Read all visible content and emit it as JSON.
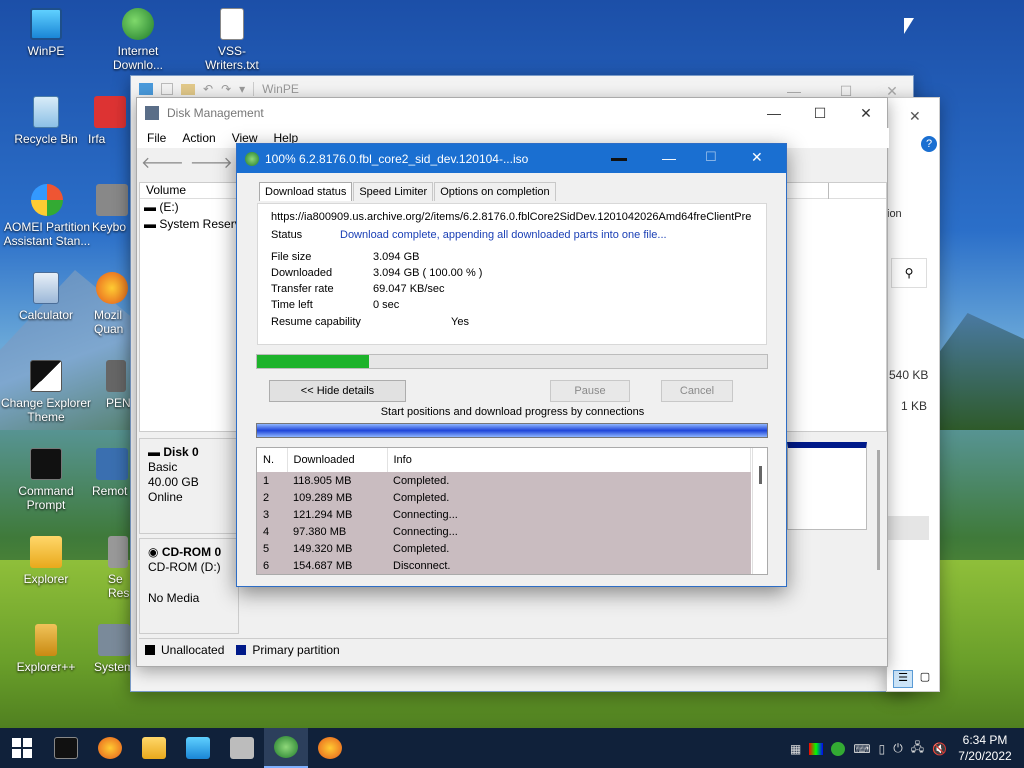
{
  "desktop": {
    "icons": [
      {
        "label": "WinPE",
        "icon": "monitor-icon"
      },
      {
        "label": "Internet Downlo...",
        "icon": "idm-globe-icon"
      },
      {
        "label": "VSS-Writers.txt",
        "icon": "text-file-icon"
      },
      {
        "label": "Recycle Bin",
        "icon": "recycle-bin-icon"
      },
      {
        "label": "Irfa",
        "icon": "app-icon"
      },
      {
        "label": "AOMEI Partition Assistant Stan...",
        "icon": "aomei-icon"
      },
      {
        "label": "Keybo",
        "icon": "app-icon"
      },
      {
        "label": "Calculator",
        "icon": "calculator-icon"
      },
      {
        "label": "Mozil Quan",
        "icon": "firefox-icon"
      },
      {
        "label": "Change Explorer Theme",
        "icon": "theme-icon"
      },
      {
        "label": "PEN",
        "icon": "app-icon"
      },
      {
        "label": "Command Prompt",
        "icon": "cmd-icon"
      },
      {
        "label": "Remot",
        "icon": "app-icon"
      },
      {
        "label": "Explorer",
        "icon": "folder-icon"
      },
      {
        "label": "Se Res",
        "icon": "app-icon"
      },
      {
        "label": "Explorer++",
        "icon": "explorer-plus-icon"
      },
      {
        "label": "System",
        "icon": "app-icon"
      }
    ]
  },
  "back_window": {
    "title": "WinPE"
  },
  "right_window": {
    "text_ion": "ion",
    "size1": "540 KB",
    "size2": "1 KB"
  },
  "disk_mgmt": {
    "title": "Disk Management",
    "menu": [
      "File",
      "Action",
      "View",
      "Help"
    ],
    "volume_header": "Volume",
    "volumes": [
      "(E:)",
      "System Reserve"
    ],
    "disk0": {
      "name": "Disk 0",
      "type": "Basic",
      "size": "40.00 GB",
      "status": "Online"
    },
    "cdrom0": {
      "name": "CD-ROM 0",
      "type": "CD-ROM (D:)",
      "status": "No Media"
    },
    "legend": {
      "unallocated": "Unallocated",
      "primary": "Primary partition"
    }
  },
  "idm": {
    "title": "100% 6.2.8176.0.fbl_core2_sid_dev.120104-...iso",
    "tabs": [
      "Download status",
      "Speed Limiter",
      "Options on completion"
    ],
    "url": "https://ia800909.us.archive.org/2/items/6.2.8176.0.fblCore2SidDev.1201042026Amd64freClientPre",
    "status_label": "Status",
    "status_value": "Download complete, appending all downloaded parts into one file...",
    "file_size_label": "File size",
    "file_size": "3.094  GB",
    "downloaded_label": "Downloaded",
    "downloaded": "3.094  GB  ( 100.00 % )",
    "transfer_rate_label": "Transfer rate",
    "transfer_rate": "69.047  KB/sec",
    "time_left_label": "Time left",
    "time_left": "0 sec",
    "resume_label": "Resume capability",
    "resume": "Yes",
    "progress_fraction": 0.22,
    "hide_details": "<< Hide details",
    "pause": "Pause",
    "cancel": "Cancel",
    "connections_caption": "Start positions and download progress by connections",
    "columns": [
      "N.",
      "Downloaded",
      "Info"
    ],
    "connections": [
      {
        "n": "1",
        "downloaded": "118.905  MB",
        "info": "Completed."
      },
      {
        "n": "2",
        "downloaded": "109.289  MB",
        "info": "Completed."
      },
      {
        "n": "3",
        "downloaded": "121.294  MB",
        "info": "Connecting..."
      },
      {
        "n": "4",
        "downloaded": "97.380  MB",
        "info": "Connecting..."
      },
      {
        "n": "5",
        "downloaded": "149.320  MB",
        "info": "Completed."
      },
      {
        "n": "6",
        "downloaded": "154.687  MB",
        "info": "Disconnect."
      }
    ]
  },
  "taskbar": {
    "time": "6:34 PM",
    "date": "7/20/2022"
  },
  "colors": {
    "idm_title": "#1a6fd1",
    "progress_green": "#1db32b",
    "link_blue": "#1a3fb5",
    "connection_row": "#c9bcc0"
  }
}
